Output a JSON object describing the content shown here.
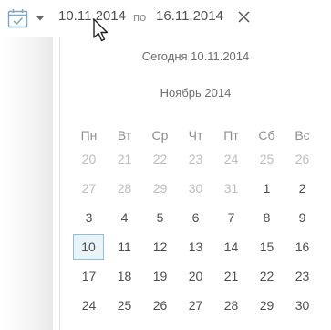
{
  "range": {
    "from": "10.11.2014",
    "separator": "по",
    "to": "16.11.2014"
  },
  "icons": {
    "calendar": "calendar-check-icon",
    "caret": "caret-down-icon",
    "clear": "close-icon",
    "cursor": "mouse-cursor-icon"
  },
  "calendar": {
    "today_label": "Сегодня 10.11.2014",
    "month_title": "Ноябрь 2014",
    "weekdays": [
      "Пн",
      "Вт",
      "Ср",
      "Чт",
      "Пт",
      "Сб",
      "Вс"
    ],
    "weeks": [
      [
        "20",
        "21",
        "22",
        "23",
        "24",
        "25",
        "26"
      ],
      [
        "27",
        "28",
        "29",
        "30",
        "31",
        "1",
        "2"
      ],
      [
        "3",
        "4",
        "5",
        "6",
        "7",
        "8",
        "9"
      ],
      [
        "10",
        "11",
        "12",
        "13",
        "14",
        "15",
        "16"
      ],
      [
        "17",
        "18",
        "19",
        "20",
        "21",
        "22",
        "23"
      ],
      [
        "24",
        "25",
        "26",
        "27",
        "28",
        "29",
        "30"
      ]
    ],
    "selected_day": "10"
  },
  "colors": {
    "text": "#505050",
    "muted": "#bdbdbd",
    "selection_border": "#8fc0db",
    "selection_fill": "#eaf3f8"
  }
}
